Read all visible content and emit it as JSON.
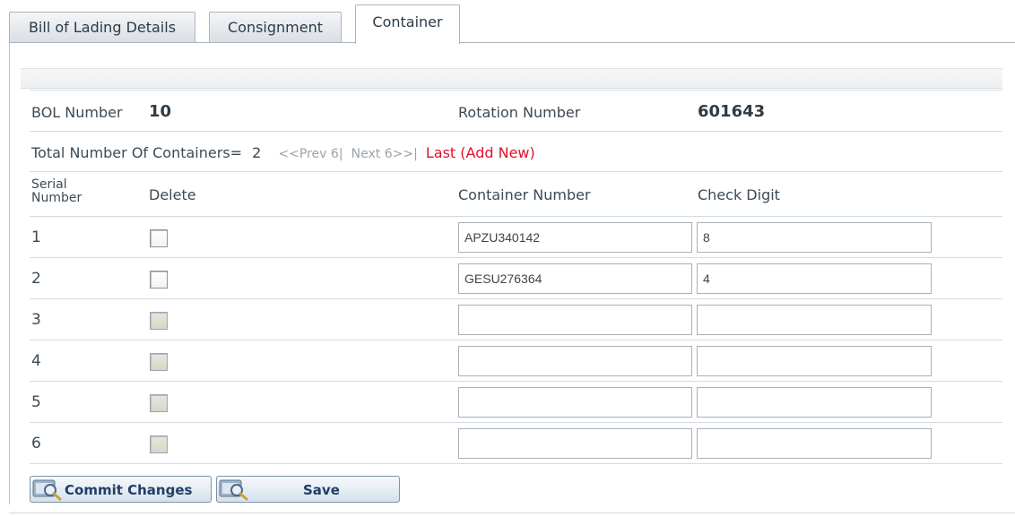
{
  "tabs": [
    {
      "label": "Bill of Lading Details",
      "active": false
    },
    {
      "label": "Consignment",
      "active": false
    },
    {
      "label": "Container",
      "active": true
    }
  ],
  "bol": {
    "label": "BOL Number",
    "value": "10"
  },
  "rotation": {
    "label": "Rotation Number",
    "value": "601643"
  },
  "summary": {
    "total_label": "Total Number Of Containers=",
    "total_value": "2",
    "prev": "<<Prev 6",
    "next": "Next 6>>",
    "last": "Last (Add New)"
  },
  "columns": {
    "serial": "Serial Number",
    "delete": "Delete",
    "container_number": "Container Number",
    "check_digit": "Check Digit"
  },
  "rows": [
    {
      "serial": "1",
      "container_number": "APZU340142",
      "check_digit": "8",
      "enabled": true
    },
    {
      "serial": "2",
      "container_number": "GESU276364",
      "check_digit": "4",
      "enabled": true
    },
    {
      "serial": "3",
      "container_number": "",
      "check_digit": "",
      "enabled": false
    },
    {
      "serial": "4",
      "container_number": "",
      "check_digit": "",
      "enabled": false
    },
    {
      "serial": "5",
      "container_number": "",
      "check_digit": "",
      "enabled": false
    },
    {
      "serial": "6",
      "container_number": "",
      "check_digit": "",
      "enabled": false
    }
  ],
  "buttons": {
    "commit": "Commit Changes",
    "save": "Save"
  },
  "icons": {
    "button_icon": "magnifier-icon"
  }
}
